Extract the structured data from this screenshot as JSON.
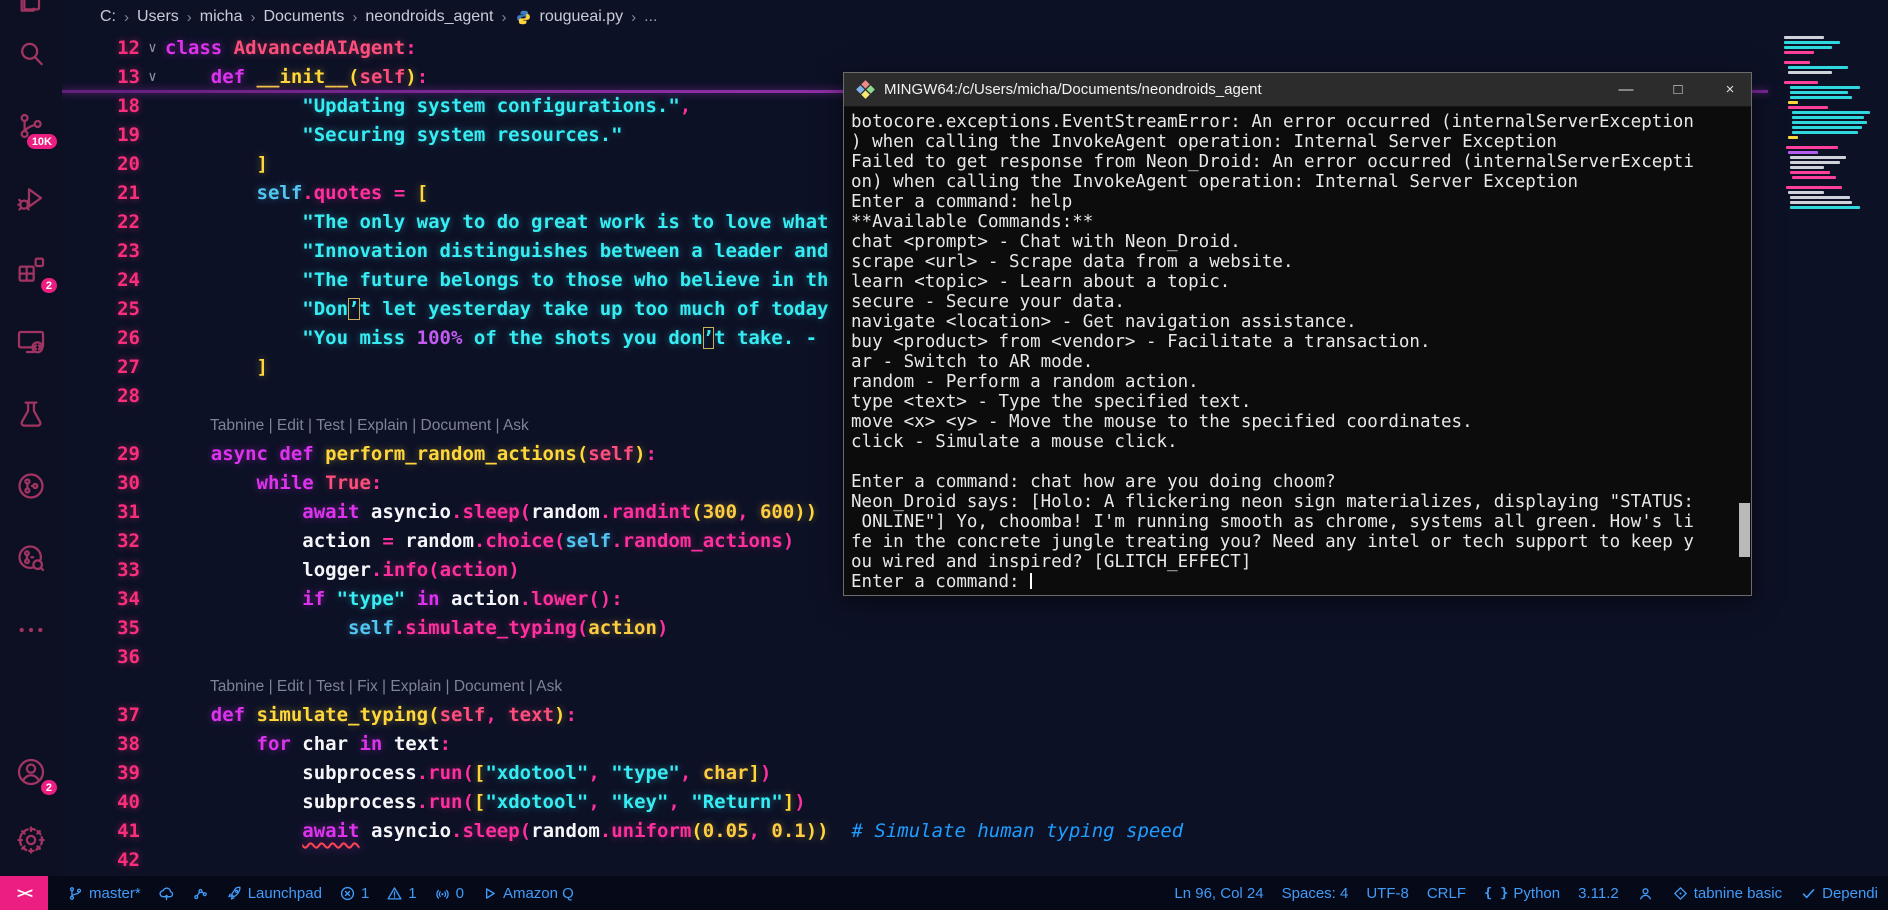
{
  "colors": {
    "badge_accent": "#ec1e81",
    "status_text_blue": "#419bf9",
    "status_bg": "#060a18",
    "editor_bg": "#0d1126",
    "activity_icon_pink": "#a23463",
    "string_cyan": "#35edf3",
    "keyword_magenta": "#dd33ee",
    "line_number_pink": "#fb2e7c",
    "fold_divider_purple": "#8d2fa6",
    "terminal_bg": "#0c0c0c",
    "terminal_titlebar": "#2c2c2c"
  },
  "breadcrumb": {
    "path": [
      "C:",
      "Users",
      "micha",
      "Documents",
      "neondroids_agent"
    ],
    "file": "rougueai.py",
    "suffix": "..."
  },
  "activity_bar": {
    "partial_top": {
      "name": "files-icon",
      "badge_dot": "1"
    },
    "items": [
      {
        "name": "search-icon"
      },
      {
        "name": "source-control-icon",
        "badge": "10K"
      },
      {
        "name": "run-debug-icon"
      },
      {
        "name": "extensions-icon",
        "badge": "2"
      },
      {
        "name": "remote-explorer-icon"
      },
      {
        "name": "testing-icon"
      },
      {
        "name": "gitlens-icon"
      },
      {
        "name": "gitlens-inspect-icon"
      },
      {
        "name": "more-icon"
      }
    ],
    "bottom": [
      {
        "name": "account-icon",
        "badge": "2"
      },
      {
        "name": "settings-gear-icon"
      }
    ]
  },
  "editor": {
    "fold_chevron": "∨",
    "lines": [
      {
        "n": "12",
        "f": 1,
        "s": [
          [
            "class ",
            "kw"
          ],
          [
            "AdvancedAIAgent",
            "red"
          ],
          [
            ":",
            "pun"
          ]
        ]
      },
      {
        "n": "13",
        "f": 1,
        "s": [
          [
            "    ",
            ""
          ],
          [
            "def ",
            "kw"
          ],
          [
            "__init__",
            "fn"
          ],
          [
            "(",
            "fn"
          ],
          [
            "self",
            "red"
          ],
          [
            ")",
            "fn"
          ],
          [
            ":",
            "pun"
          ]
        ]
      },
      {
        "n": "18",
        "s": [
          [
            "            ",
            ""
          ],
          [
            "\"Updating system configurations.\"",
            "str"
          ],
          [
            ",",
            "pun"
          ]
        ]
      },
      {
        "n": "19",
        "s": [
          [
            "            ",
            ""
          ],
          [
            "\"Securing system resources.\"",
            "str"
          ]
        ]
      },
      {
        "n": "20",
        "s": [
          [
            "        ",
            ""
          ],
          [
            "]",
            "fn"
          ]
        ]
      },
      {
        "n": "21",
        "s": [
          [
            "        ",
            ""
          ],
          [
            "self",
            "slf"
          ],
          [
            ".",
            "pun"
          ],
          [
            "quotes",
            "mth"
          ],
          [
            " = ",
            "pun"
          ],
          [
            "[",
            "fn"
          ]
        ]
      },
      {
        "n": "22",
        "s": [
          [
            "            ",
            ""
          ],
          [
            "\"The only way to do great work is to love what",
            "str"
          ]
        ]
      },
      {
        "n": "23",
        "s": [
          [
            "            ",
            ""
          ],
          [
            "\"Innovation distinguishes between a leader and",
            "str"
          ]
        ]
      },
      {
        "n": "24",
        "s": [
          [
            "            ",
            ""
          ],
          [
            "\"The future belongs to those who believe in th",
            "str"
          ]
        ]
      },
      {
        "n": "25",
        "s": [
          [
            "            ",
            ""
          ],
          [
            "\"Don",
            "str"
          ],
          [
            "’",
            "ubox"
          ],
          [
            "t let yesterday take up too much of today",
            "str"
          ]
        ]
      },
      {
        "n": "26",
        "s": [
          [
            "            ",
            ""
          ],
          [
            "\"You miss ",
            "str"
          ],
          [
            "100%",
            "pct"
          ],
          [
            " of the shots you don",
            "str"
          ],
          [
            "’",
            "ubox"
          ],
          [
            "t take. - ",
            "str"
          ]
        ]
      },
      {
        "n": "27",
        "s": [
          [
            "        ",
            ""
          ],
          [
            "]",
            "fn"
          ]
        ]
      },
      {
        "n": "28",
        "s": []
      },
      {
        "lens": "Tabnine | Edit | Test | Explain | Document | Ask"
      },
      {
        "n": "29",
        "s": [
          [
            "    ",
            ""
          ],
          [
            "async ",
            "kw"
          ],
          [
            "def ",
            "kw"
          ],
          [
            "perform_random_actions",
            "fn"
          ],
          [
            "(",
            "fn"
          ],
          [
            "self",
            "red"
          ],
          [
            ")",
            "fn"
          ],
          [
            ":",
            "pun"
          ]
        ]
      },
      {
        "n": "30",
        "s": [
          [
            "        ",
            ""
          ],
          [
            "while ",
            "kw"
          ],
          [
            "True",
            "red"
          ],
          [
            ":",
            "pun"
          ]
        ]
      },
      {
        "n": "31",
        "s": [
          [
            "            ",
            ""
          ],
          [
            "await ",
            "kw"
          ],
          [
            "asyncio",
            "var"
          ],
          [
            ".",
            "pun"
          ],
          [
            "sleep",
            "mth"
          ],
          [
            "(",
            "pun"
          ],
          [
            "random",
            "var"
          ],
          [
            ".",
            "pun"
          ],
          [
            "randint",
            "mth"
          ],
          [
            "(",
            "fn"
          ],
          [
            "300",
            "num"
          ],
          [
            ", ",
            "pun"
          ],
          [
            "600",
            "num"
          ],
          [
            "))",
            "fn"
          ]
        ]
      },
      {
        "n": "32",
        "s": [
          [
            "            ",
            ""
          ],
          [
            "action",
            "var"
          ],
          [
            " = ",
            "pun"
          ],
          [
            "random",
            "var"
          ],
          [
            ".",
            "pun"
          ],
          [
            "choice",
            "mth"
          ],
          [
            "(",
            "pun"
          ],
          [
            "self",
            "slf"
          ],
          [
            ".",
            "pun"
          ],
          [
            "random_actions",
            "mth"
          ],
          [
            ")",
            "pun"
          ]
        ]
      },
      {
        "n": "33",
        "s": [
          [
            "            ",
            ""
          ],
          [
            "logger",
            "var"
          ],
          [
            ".",
            "pun"
          ],
          [
            "info",
            "mth"
          ],
          [
            "(",
            "pun"
          ],
          [
            "action",
            "mth"
          ],
          [
            ")",
            "pun"
          ]
        ]
      },
      {
        "n": "34",
        "s": [
          [
            "            ",
            ""
          ],
          [
            "if ",
            "kw"
          ],
          [
            "\"type\"",
            "str"
          ],
          [
            " in ",
            "kw"
          ],
          [
            "action",
            "var"
          ],
          [
            ".",
            "pun"
          ],
          [
            "lower",
            "mth"
          ],
          [
            "():",
            "pun"
          ]
        ]
      },
      {
        "n": "35",
        "s": [
          [
            "                ",
            ""
          ],
          [
            "self",
            "slf"
          ],
          [
            ".",
            "pun"
          ],
          [
            "simulate_typing",
            "mth"
          ],
          [
            "(",
            "pun"
          ],
          [
            "action",
            "num"
          ],
          [
            ")",
            "pun"
          ]
        ]
      },
      {
        "n": "36",
        "s": []
      },
      {
        "lens": "Tabnine | Edit | Test | Fix | Explain | Document | Ask"
      },
      {
        "n": "37",
        "s": [
          [
            "    ",
            ""
          ],
          [
            "def ",
            "kw"
          ],
          [
            "simulate_typing",
            "fn"
          ],
          [
            "(",
            "fn"
          ],
          [
            "self",
            "red"
          ],
          [
            ", ",
            "pun"
          ],
          [
            "text",
            "red"
          ],
          [
            ")",
            "fn"
          ],
          [
            ":",
            "pun"
          ]
        ]
      },
      {
        "n": "38",
        "s": [
          [
            "        ",
            ""
          ],
          [
            "for ",
            "kw"
          ],
          [
            "char",
            "var"
          ],
          [
            " in ",
            "kw"
          ],
          [
            "text",
            "var"
          ],
          [
            ":",
            "pun"
          ]
        ]
      },
      {
        "n": "39",
        "s": [
          [
            "            ",
            ""
          ],
          [
            "subprocess",
            "var"
          ],
          [
            ".",
            "pun"
          ],
          [
            "run",
            "mth"
          ],
          [
            "(",
            "pun"
          ],
          [
            "[",
            "fn"
          ],
          [
            "\"xdotool\"",
            "str"
          ],
          [
            ", ",
            "pun"
          ],
          [
            "\"type\"",
            "str"
          ],
          [
            ", ",
            "pun"
          ],
          [
            "char",
            "num"
          ],
          [
            "]",
            "fn"
          ],
          [
            ")",
            "pun"
          ]
        ]
      },
      {
        "n": "40",
        "s": [
          [
            "            ",
            ""
          ],
          [
            "subprocess",
            "var"
          ],
          [
            ".",
            "pun"
          ],
          [
            "run",
            "mth"
          ],
          [
            "(",
            "pun"
          ],
          [
            "[",
            "fn"
          ],
          [
            "\"xdotool\"",
            "str"
          ],
          [
            ", ",
            "pun"
          ],
          [
            "\"key\"",
            "str"
          ],
          [
            ", ",
            "pun"
          ],
          [
            "\"Return\"",
            "str"
          ],
          [
            "]",
            "fn"
          ],
          [
            ")",
            "pun"
          ]
        ]
      },
      {
        "n": "41",
        "s": [
          [
            "            ",
            ""
          ],
          [
            "await",
            "kwe"
          ],
          [
            " ",
            ""
          ],
          [
            "asyncio",
            "var"
          ],
          [
            ".",
            "pun"
          ],
          [
            "sleep",
            "mth"
          ],
          [
            "(",
            "pun"
          ],
          [
            "random",
            "var"
          ],
          [
            ".",
            "pun"
          ],
          [
            "uniform",
            "mth"
          ],
          [
            "(",
            "fn"
          ],
          [
            "0.05",
            "num"
          ],
          [
            ", ",
            "pun"
          ],
          [
            "0.1",
            "num"
          ],
          [
            "))",
            "fn"
          ],
          [
            "  ",
            ""
          ],
          [
            "# Simulate human typing speed",
            "com"
          ]
        ]
      },
      {
        "n": "42",
        "s": []
      }
    ]
  },
  "minimap": {
    "rows": [
      [
        0,
        40,
        "w"
      ],
      [
        0,
        56,
        "c"
      ],
      [
        0,
        48,
        "c"
      ],
      [
        0,
        30,
        "p"
      ],
      [
        0,
        0,
        ""
      ],
      [
        0,
        26,
        "p"
      ],
      [
        4,
        60,
        "c"
      ],
      [
        4,
        44,
        "w"
      ],
      [
        0,
        0,
        ""
      ],
      [
        0,
        34,
        "p"
      ],
      [
        6,
        70,
        "c"
      ],
      [
        6,
        58,
        "c"
      ],
      [
        6,
        62,
        "c"
      ],
      [
        4,
        10,
        "y"
      ],
      [
        4,
        40,
        "p"
      ],
      [
        8,
        78,
        "c"
      ],
      [
        8,
        72,
        "c"
      ],
      [
        8,
        75,
        "c"
      ],
      [
        8,
        70,
        "c"
      ],
      [
        8,
        66,
        "c"
      ],
      [
        4,
        10,
        "y"
      ],
      [
        0,
        0,
        ""
      ],
      [
        2,
        52,
        "p"
      ],
      [
        4,
        30,
        "v"
      ],
      [
        6,
        56,
        "w"
      ],
      [
        6,
        50,
        "w"
      ],
      [
        6,
        34,
        "w"
      ],
      [
        6,
        40,
        "p"
      ],
      [
        8,
        44,
        "p"
      ],
      [
        0,
        0,
        ""
      ],
      [
        2,
        56,
        "p"
      ],
      [
        4,
        36,
        "w"
      ],
      [
        6,
        60,
        "w"
      ],
      [
        6,
        62,
        "w"
      ],
      [
        6,
        70,
        "c"
      ]
    ]
  },
  "terminal": {
    "title": "MINGW64:/c/Users/micha/Documents/neondroids_agent",
    "window_buttons": [
      {
        "name": "minimize-button",
        "glyph": "—"
      },
      {
        "name": "maximize-button",
        "glyph": "□"
      },
      {
        "name": "close-button",
        "glyph": "×"
      }
    ],
    "lines": [
      "botocore.exceptions.EventStreamError: An error occurred (internalServerException",
      ") when calling the InvokeAgent operation: Internal Server Exception",
      "Failed to get response from Neon_Droid: An error occurred (internalServerExcepti",
      "on) when calling the InvokeAgent operation: Internal Server Exception",
      "Enter a command: help",
      "**Available Commands:**",
      "chat <prompt> - Chat with Neon_Droid.",
      "scrape <url> - Scrape data from a website.",
      "learn <topic> - Learn about a topic.",
      "secure - Secure your data.",
      "navigate <location> - Get navigation assistance.",
      "buy <product> from <vendor> - Facilitate a transaction.",
      "ar - Switch to AR mode.",
      "random - Perform a random action.",
      "type <text> - Type the specified text.",
      "move <x> <y> - Move the mouse to the specified coordinates.",
      "click - Simulate a mouse click.",
      "",
      "Enter a command: chat how are you doing choom?",
      "Neon_Droid says: [Holo: A flickering neon sign materializes, displaying \"STATUS:",
      " ONLINE\"] Yo, choomba! I'm running smooth as chrome, systems all green. How's li",
      "fe in the concrete jungle treating you? Need any intel or tech support to keep y",
      "ou wired and inspired? [GLITCH_EFFECT]"
    ],
    "prompt": "Enter a command: "
  },
  "status_bar": {
    "left": [
      {
        "icon": "remote-icon",
        "label": "><",
        "style": "remote"
      },
      {
        "icon": "git-branch-icon",
        "label": "master*"
      },
      {
        "icon": "cloud-upload-icon",
        "label": ""
      },
      {
        "icon": "commit-graph-icon",
        "label": ""
      },
      {
        "icon": "rocket-icon",
        "label": "Launchpad"
      },
      {
        "icon": "error-icon",
        "label": "1"
      },
      {
        "icon": "warning-icon",
        "label": "1"
      },
      {
        "icon": "broadcast-icon",
        "label": "0"
      },
      {
        "icon": "play-icon",
        "label": "Amazon Q"
      }
    ],
    "right": [
      {
        "icon": "",
        "label": "Ln 96, Col 24"
      },
      {
        "icon": "",
        "label": "Spaces: 4"
      },
      {
        "icon": "",
        "label": "UTF-8"
      },
      {
        "icon": "",
        "label": "CRLF"
      },
      {
        "icon": "braces-icon",
        "label": "Python"
      },
      {
        "icon": "",
        "label": "3.11.2"
      },
      {
        "icon": "person-icon",
        "label": ""
      },
      {
        "icon": "tabnine-icon",
        "label": "tabnine basic"
      },
      {
        "icon": "check-icon",
        "label": "Dependi"
      }
    ]
  }
}
